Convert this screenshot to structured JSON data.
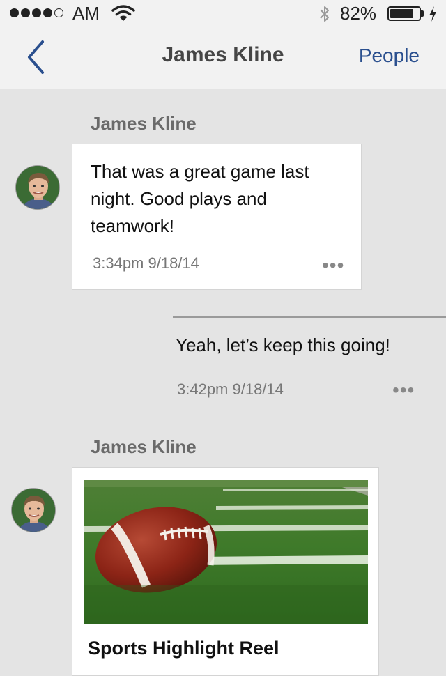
{
  "status_bar": {
    "carrier": "AM",
    "battery_percent": "82%",
    "battery_level": 0.82
  },
  "nav": {
    "back_icon": "chevron-left-icon",
    "title": "James Kline",
    "people_label": "People"
  },
  "messages": [
    {
      "sender": "James Kline",
      "text": "That was a great game last night. Good plays and teamwork!",
      "timestamp": "3:34pm 9/18/14",
      "more_label": "•••"
    },
    {
      "text": "Yeah, let’s keep this going!",
      "timestamp": "3:42pm 9/18/14",
      "more_label": "•••"
    },
    {
      "sender": "James Kline",
      "attachment_title": "Sports Highlight Reel"
    }
  ],
  "colors": {
    "accent": "#2a4f8e",
    "background": "#e4e4e4",
    "navbar": "#f2f2f2"
  }
}
